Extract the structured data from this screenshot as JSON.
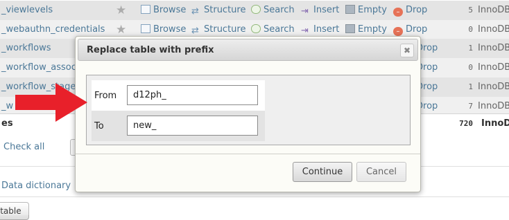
{
  "table": {
    "rows": [
      {
        "name": "_viewlevels",
        "rows": "5",
        "engine": "InnoDB"
      },
      {
        "name": "_webauthn_credentials",
        "rows": "0",
        "engine": "InnoDB"
      },
      {
        "name": "_workflows",
        "rows": "1",
        "engine": "InnoDB"
      },
      {
        "name": "_workflow_associ",
        "rows": "0",
        "engine": "InnoDB"
      },
      {
        "name": "_workflow_stages",
        "rows": "1",
        "engine": "InnoDB"
      },
      {
        "name": "_w",
        "rows": "7",
        "engine": "InnoDB"
      }
    ],
    "actions": {
      "browse": "Browse",
      "structure": "Structure",
      "search": "Search",
      "insert": "Insert",
      "empty": "Empty",
      "drop": "Drop"
    },
    "summary": {
      "label": "es",
      "total": "720",
      "engine": "InnoD"
    },
    "check_all": "Check all"
  },
  "footer": {
    "data_dictionary": "Data dictionary",
    "create_table": "e table"
  },
  "dialog": {
    "title": "Replace table with prefix",
    "close_glyph": "✖",
    "from_label": "From",
    "from_value": "d12ph_",
    "to_label": "To",
    "to_value": "new_",
    "continue_label": "Continue",
    "cancel_label": "Cancel"
  },
  "colors": {
    "link": "#235a81",
    "arrow": "#e8202a",
    "row_odd": "#dfdfdf",
    "row_even": "#ededed"
  }
}
